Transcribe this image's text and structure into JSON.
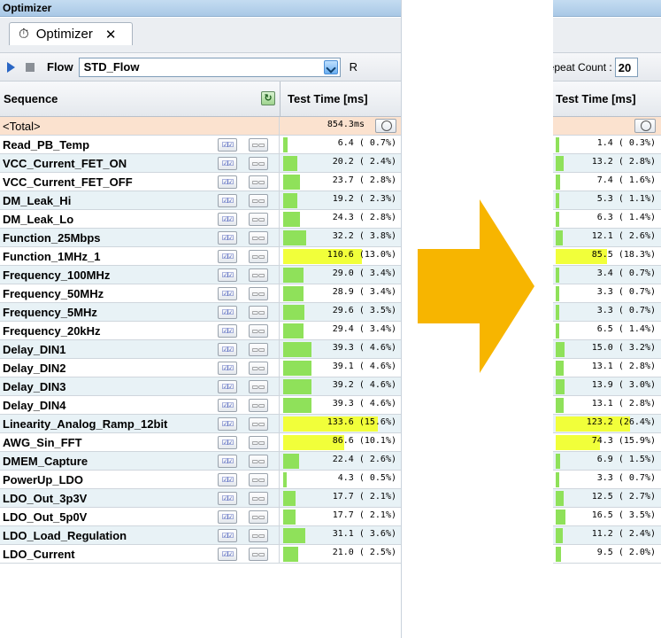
{
  "left_panel": {
    "title": "Optimizer",
    "tab_label": "Optimizer",
    "tab_close": "✕",
    "flow_label": "Flow",
    "flow_value": "STD_Flow",
    "right_hint": "R",
    "col_sequence": "Sequence",
    "col_time": "Test Time [ms]",
    "total_label": "<Total>",
    "total_value": "854.3ms",
    "rows": [
      {
        "name": "Read_PB_Temp",
        "time": "6.4 ( 0.7%)",
        "pct": 0.7
      },
      {
        "name": "VCC_Current_FET_ON",
        "time": "20.2 ( 2.4%)",
        "pct": 2.4
      },
      {
        "name": "VCC_Current_FET_OFF",
        "time": "23.7 ( 2.8%)",
        "pct": 2.8
      },
      {
        "name": "DM_Leak_Hi",
        "time": "19.2 ( 2.3%)",
        "pct": 2.3
      },
      {
        "name": "DM_Leak_Lo",
        "time": "24.3 ( 2.8%)",
        "pct": 2.8
      },
      {
        "name": "Function_25Mbps",
        "time": "32.2 ( 3.8%)",
        "pct": 3.8
      },
      {
        "name": "Function_1MHz_1",
        "time": "110.6 (13.0%)",
        "pct": 13.0
      },
      {
        "name": "Frequency_100MHz",
        "time": "29.0 ( 3.4%)",
        "pct": 3.4
      },
      {
        "name": "Frequency_50MHz",
        "time": "28.9 ( 3.4%)",
        "pct": 3.4
      },
      {
        "name": "Frequency_5MHz",
        "time": "29.6 ( 3.5%)",
        "pct": 3.5
      },
      {
        "name": "Frequency_20kHz",
        "time": "29.4 ( 3.4%)",
        "pct": 3.4
      },
      {
        "name": "Delay_DIN1",
        "time": "39.3 ( 4.6%)",
        "pct": 4.6
      },
      {
        "name": "Delay_DIN2",
        "time": "39.1 ( 4.6%)",
        "pct": 4.6
      },
      {
        "name": "Delay_DIN3",
        "time": "39.2 ( 4.6%)",
        "pct": 4.6
      },
      {
        "name": "Delay_DIN4",
        "time": "39.3 ( 4.6%)",
        "pct": 4.6
      },
      {
        "name": "Linearity_Analog_Ramp_12bit",
        "time": "133.6 (15.6%)",
        "pct": 15.6
      },
      {
        "name": "AWG_Sin_FFT",
        "time": "86.6 (10.1%)",
        "pct": 10.1
      },
      {
        "name": "DMEM_Capture",
        "time": "22.4 ( 2.6%)",
        "pct": 2.6
      },
      {
        "name": "PowerUp_LDO",
        "time": "4.3 ( 0.5%)",
        "pct": 0.5
      },
      {
        "name": "LDO_Out_3p3V",
        "time": "17.7 ( 2.1%)",
        "pct": 2.1
      },
      {
        "name": "LDO_Out_5p0V",
        "time": "17.7 ( 2.1%)",
        "pct": 2.1
      },
      {
        "name": "LDO_Load_Regulation",
        "time": "31.1 ( 3.6%)",
        "pct": 3.6
      },
      {
        "name": "LDO_Current",
        "time": "21.0 ( 2.5%)",
        "pct": 2.5
      }
    ]
  },
  "right_panel": {
    "repeat_label": "Repeat Count :",
    "repeat_value": "20",
    "col_time": "Test Time [ms]",
    "rows": [
      {
        "time": "1.4 ( 0.3%)",
        "pct": 0.3
      },
      {
        "time": "13.2 ( 2.8%)",
        "pct": 2.8
      },
      {
        "time": "7.4 ( 1.6%)",
        "pct": 1.6
      },
      {
        "time": "5.3 ( 1.1%)",
        "pct": 1.1
      },
      {
        "time": "6.3 ( 1.4%)",
        "pct": 1.4
      },
      {
        "time": "12.1 ( 2.6%)",
        "pct": 2.6
      },
      {
        "time": "85.5 (18.3%)",
        "pct": 18.3
      },
      {
        "time": "3.4 ( 0.7%)",
        "pct": 0.7
      },
      {
        "time": "3.3 ( 0.7%)",
        "pct": 0.7
      },
      {
        "time": "3.3 ( 0.7%)",
        "pct": 0.7
      },
      {
        "time": "6.5 ( 1.4%)",
        "pct": 1.4
      },
      {
        "time": "15.0 ( 3.2%)",
        "pct": 3.2
      },
      {
        "time": "13.1 ( 2.8%)",
        "pct": 2.8
      },
      {
        "time": "13.9 ( 3.0%)",
        "pct": 3.0
      },
      {
        "time": "13.1 ( 2.8%)",
        "pct": 2.8
      },
      {
        "time": "123.2 (26.4%)",
        "pct": 26.4
      },
      {
        "time": "74.3 (15.9%)",
        "pct": 15.9
      },
      {
        "time": "6.9 ( 1.5%)",
        "pct": 1.5
      },
      {
        "time": "3.3 ( 0.7%)",
        "pct": 0.7
      },
      {
        "time": "12.5 ( 2.7%)",
        "pct": 2.7
      },
      {
        "time": "16.5 ( 3.5%)",
        "pct": 3.5
      },
      {
        "time": "11.2 ( 2.4%)",
        "pct": 2.4
      },
      {
        "time": "9.5 ( 2.0%)",
        "pct": 2.0
      }
    ]
  },
  "colors": {
    "arrow": "#f7b500",
    "bar_green": "#8fe15a",
    "bar_yellow": "#f1ff3a",
    "row_alt": "#e8f2f6",
    "total_row": "#fbe2cf"
  },
  "icons": {
    "tab": "stopwatch-icon",
    "run": "play-icon",
    "stop": "stop-icon",
    "refresh": "refresh-icon",
    "dropdown": "chevron-down-icon"
  }
}
